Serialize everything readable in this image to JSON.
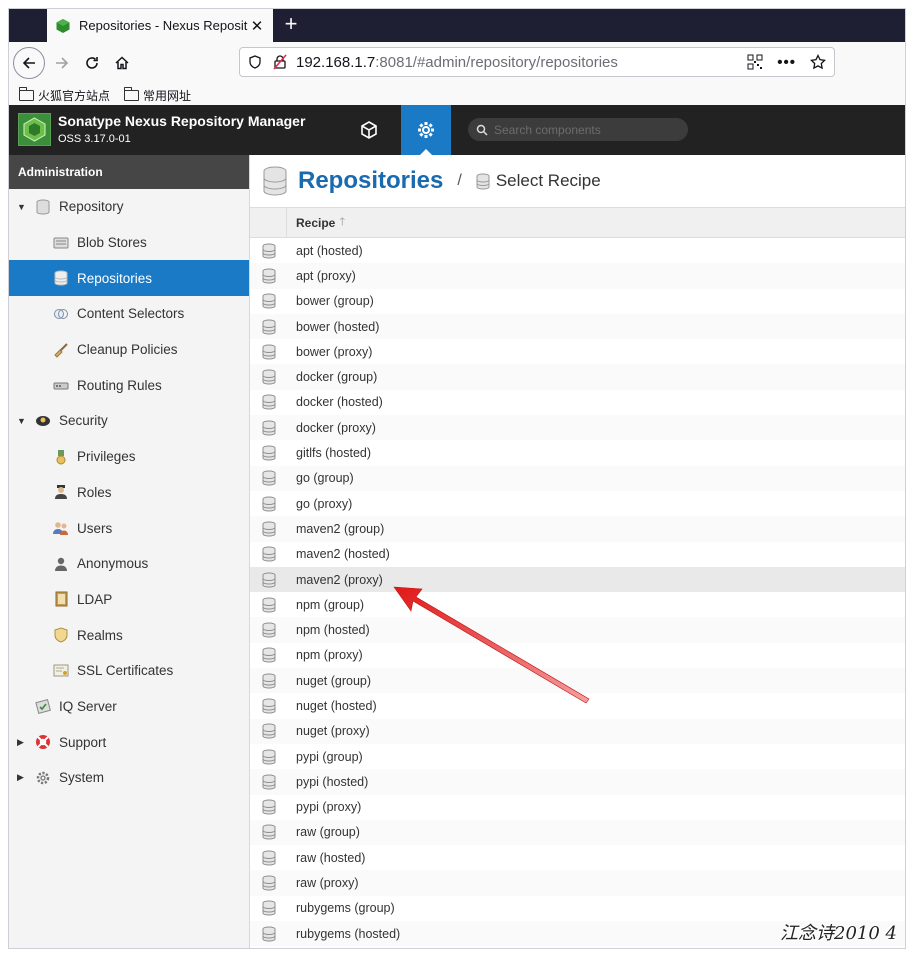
{
  "browser": {
    "tab_title": "Repositories - Nexus Reposit",
    "new_tab": "+",
    "url_host": "192.168.1.7",
    "url_rest": ":8081/#admin/repository/repositories",
    "bookmarks": [
      "火狐官方站点",
      "常用网址"
    ]
  },
  "header": {
    "title": "Sonatype Nexus Repository Manager",
    "version": "OSS 3.17.0-01",
    "search_placeholder": "Search components"
  },
  "sidebar": {
    "heading": "Administration",
    "items": [
      {
        "label": "Repository"
      },
      {
        "label": "Blob Stores"
      },
      {
        "label": "Repositories"
      },
      {
        "label": "Content Selectors"
      },
      {
        "label": "Cleanup Policies"
      },
      {
        "label": "Routing Rules"
      },
      {
        "label": "Security"
      },
      {
        "label": "Privileges"
      },
      {
        "label": "Roles"
      },
      {
        "label": "Users"
      },
      {
        "label": "Anonymous"
      },
      {
        "label": "LDAP"
      },
      {
        "label": "Realms"
      },
      {
        "label": "SSL Certificates"
      },
      {
        "label": "IQ Server"
      },
      {
        "label": "Support"
      },
      {
        "label": "System"
      }
    ]
  },
  "main": {
    "title": "Repositories",
    "breadcrumb_sep": "/",
    "breadcrumb": "Select Recipe",
    "column": "Recipe",
    "rows": [
      "apt (hosted)",
      "apt (proxy)",
      "bower (group)",
      "bower (hosted)",
      "bower (proxy)",
      "docker (group)",
      "docker (hosted)",
      "docker (proxy)",
      "gitlfs (hosted)",
      "go (group)",
      "go (proxy)",
      "maven2 (group)",
      "maven2 (hosted)",
      "maven2 (proxy)",
      "npm (group)",
      "npm (hosted)",
      "npm (proxy)",
      "nuget (group)",
      "nuget (hosted)",
      "nuget (proxy)",
      "pypi (group)",
      "pypi (hosted)",
      "pypi (proxy)",
      "raw (group)",
      "raw (hosted)",
      "raw (proxy)",
      "rubygems (group)",
      "rubygems (hosted)"
    ]
  },
  "watermark": "江念诗2010 4",
  "colors": {
    "accent": "#1a7ac5",
    "header": "#222222",
    "arrow": "#e02020"
  }
}
